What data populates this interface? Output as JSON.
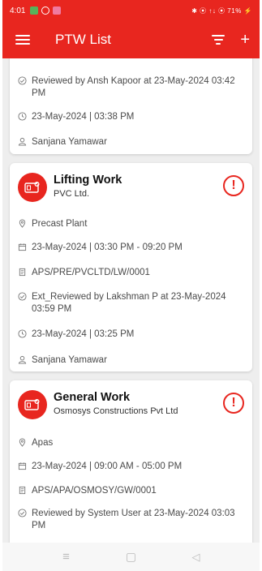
{
  "status_bar": {
    "time": "4:01",
    "right": "✱ ⦿ ↑↓ ⦿ 71% ⚡"
  },
  "app_bar": {
    "title": "PTW List"
  },
  "cards": [
    {
      "reviewed": "Reviewed by Ansh Kapoor at 23-May-2024 03:42 PM",
      "created": "23-May-2024 | 03:38 PM",
      "user": "Sanjana Yamawar"
    },
    {
      "title": "Lifting Work",
      "company": "PVC Ltd.",
      "location": "Precast Plant",
      "schedule": "23-May-2024 | 03:30 PM - 09:20 PM",
      "permit_no": "APS/PRE/PVCLTD/LW/0001",
      "reviewed": "Ext_Reviewed by Lakshman P at 23-May-2024 03:59 PM",
      "created": "23-May-2024 | 03:25 PM",
      "user": "Sanjana Yamawar"
    },
    {
      "title": "General Work",
      "company": "Osmosys Constructions Pvt Ltd",
      "location": "Apas",
      "schedule": "23-May-2024 | 09:00 AM - 05:00 PM",
      "permit_no": "APS/APA/OSMOSY/GW/0001",
      "reviewed": "Reviewed by System User at 23-May-2024 03:03 PM"
    }
  ],
  "icons": {
    "alert": "!",
    "nav_recents": "≡",
    "nav_home": "▢",
    "nav_back": "◁"
  }
}
